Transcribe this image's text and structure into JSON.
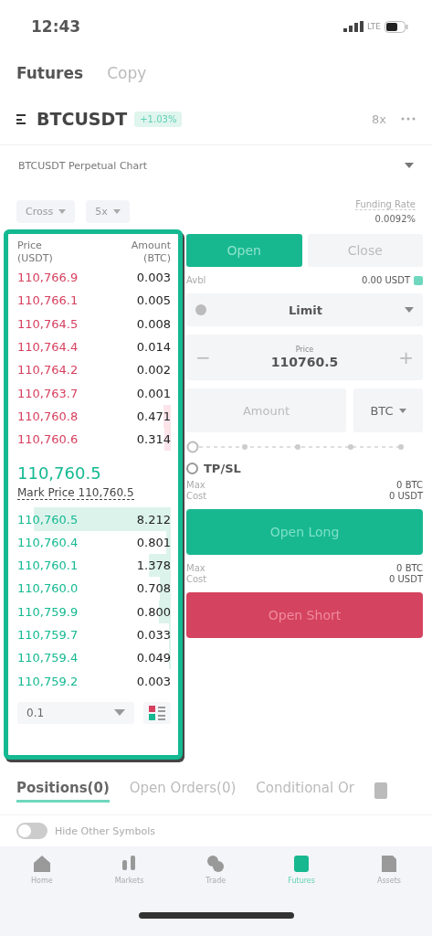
{
  "status_bar": {
    "time": "12:43",
    "network": "LTE"
  },
  "top_tabs": [
    {
      "label": "Futures",
      "selected": true
    },
    {
      "label": "Copy",
      "selected": false
    }
  ],
  "symbol": {
    "name": "BTCUSDT",
    "change": "+1.03%",
    "leverage": "8x"
  },
  "chart_bar": {
    "label": "BTCUSDT Perpetual Chart"
  },
  "margin_mode": "Cross",
  "leverage_select": "5x",
  "funding": {
    "label": "Funding Rate",
    "value": "0.0092%"
  },
  "order_book": {
    "price_header": "Price",
    "price_unit": "(USDT)",
    "amount_header": "Amount",
    "amount_unit": "(BTC)",
    "asks": [
      {
        "price": "110,766.9",
        "amount": "0.003"
      },
      {
        "price": "110,766.1",
        "amount": "0.005"
      },
      {
        "price": "110,764.5",
        "amount": "0.008"
      },
      {
        "price": "110,764.4",
        "amount": "0.014"
      },
      {
        "price": "110,764.2",
        "amount": "0.002"
      },
      {
        "price": "110,763.7",
        "amount": "0.001"
      },
      {
        "price": "110,760.8",
        "amount": "0.471"
      },
      {
        "price": "110,760.6",
        "amount": "0.314"
      }
    ],
    "last_price": "110,760.5",
    "mark_price": "Mark Price 110,760.5",
    "bids": [
      {
        "price": "110,760.5",
        "amount": "8.212"
      },
      {
        "price": "110,760.4",
        "amount": "0.801"
      },
      {
        "price": "110,760.1",
        "amount": "1.378"
      },
      {
        "price": "110,760.0",
        "amount": "0.708"
      },
      {
        "price": "110,759.9",
        "amount": "0.800"
      },
      {
        "price": "110,759.7",
        "amount": "0.033"
      },
      {
        "price": "110,759.4",
        "amount": "0.049"
      },
      {
        "price": "110,759.2",
        "amount": "0.003"
      }
    ],
    "precision": "0.1"
  },
  "trade_tabs": [
    {
      "label": "Open",
      "selected": true
    },
    {
      "label": "Close",
      "selected": false
    }
  ],
  "avail": {
    "label": "Avbl",
    "value": "0.00 USDT"
  },
  "order_type": "Limit",
  "price_field": {
    "label": "Price",
    "value": "110760.5",
    "minus": "−",
    "plus": "+"
  },
  "amount_field": {
    "placeholder": "Amount",
    "unit": "BTC"
  },
  "leverage_slider": {
    "level": 0
  },
  "tpsl": "TP/SL",
  "long_info": [
    {
      "label": "Max",
      "value": "0 BTC"
    },
    {
      "label": "Cost",
      "value": "0 USDT"
    }
  ],
  "long_button": "Open Long",
  "short_info": [
    {
      "label": "Max",
      "value": "0 BTC"
    },
    {
      "label": "Cost",
      "value": "0 USDT"
    }
  ],
  "short_button": "Open Short",
  "bottom_tabs": [
    {
      "label": "Positions(0)",
      "selected": true
    },
    {
      "label": "Open Orders(0)",
      "selected": false
    },
    {
      "label": "Conditional Or",
      "selected": false
    }
  ],
  "hide_other": {
    "label": "Hide Other Symbols",
    "checked": false
  },
  "nav": [
    {
      "label": "Home",
      "kind": "home",
      "selected": false
    },
    {
      "label": "Markets",
      "kind": "markets",
      "selected": false
    },
    {
      "label": "Trade",
      "kind": "trade",
      "selected": false
    },
    {
      "label": "Futures",
      "kind": "futures",
      "selected": true
    },
    {
      "label": "Assets",
      "kind": "assets",
      "selected": false
    }
  ]
}
